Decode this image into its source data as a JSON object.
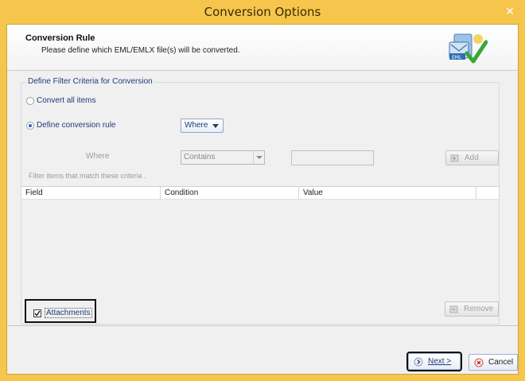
{
  "window": {
    "title": "Conversion Options",
    "close_glyph": "✕"
  },
  "header": {
    "title": "Conversion Rule",
    "description": "Please define which EML/EMLX file(s) will be converted.",
    "icon": "eml-checkmark-icon"
  },
  "filter_group": {
    "legend": "Define Filter Criteria for Conversion",
    "convert_all_label": "Convert all items",
    "define_rule_label": "Define conversion rule",
    "selected_option": "Define conversion rule",
    "where_dropdown_value": "Where",
    "where_label": "Where",
    "condition_value": "Contains",
    "value_input": "",
    "add_label": "Add",
    "filter_caption": "Filter items that match these criteria .",
    "columns": [
      "Field",
      "Condition",
      "Value"
    ],
    "rows": [],
    "attachments_label": "Attachments",
    "attachments_checked": true,
    "remove_label": "Remove"
  },
  "footer": {
    "next_label": "Next >",
    "cancel_label": "Cancel"
  },
  "colors": {
    "title_bar": "#f6c54c",
    "accent_text": "#1d3d79",
    "body_bg": "#f0f0f0"
  }
}
